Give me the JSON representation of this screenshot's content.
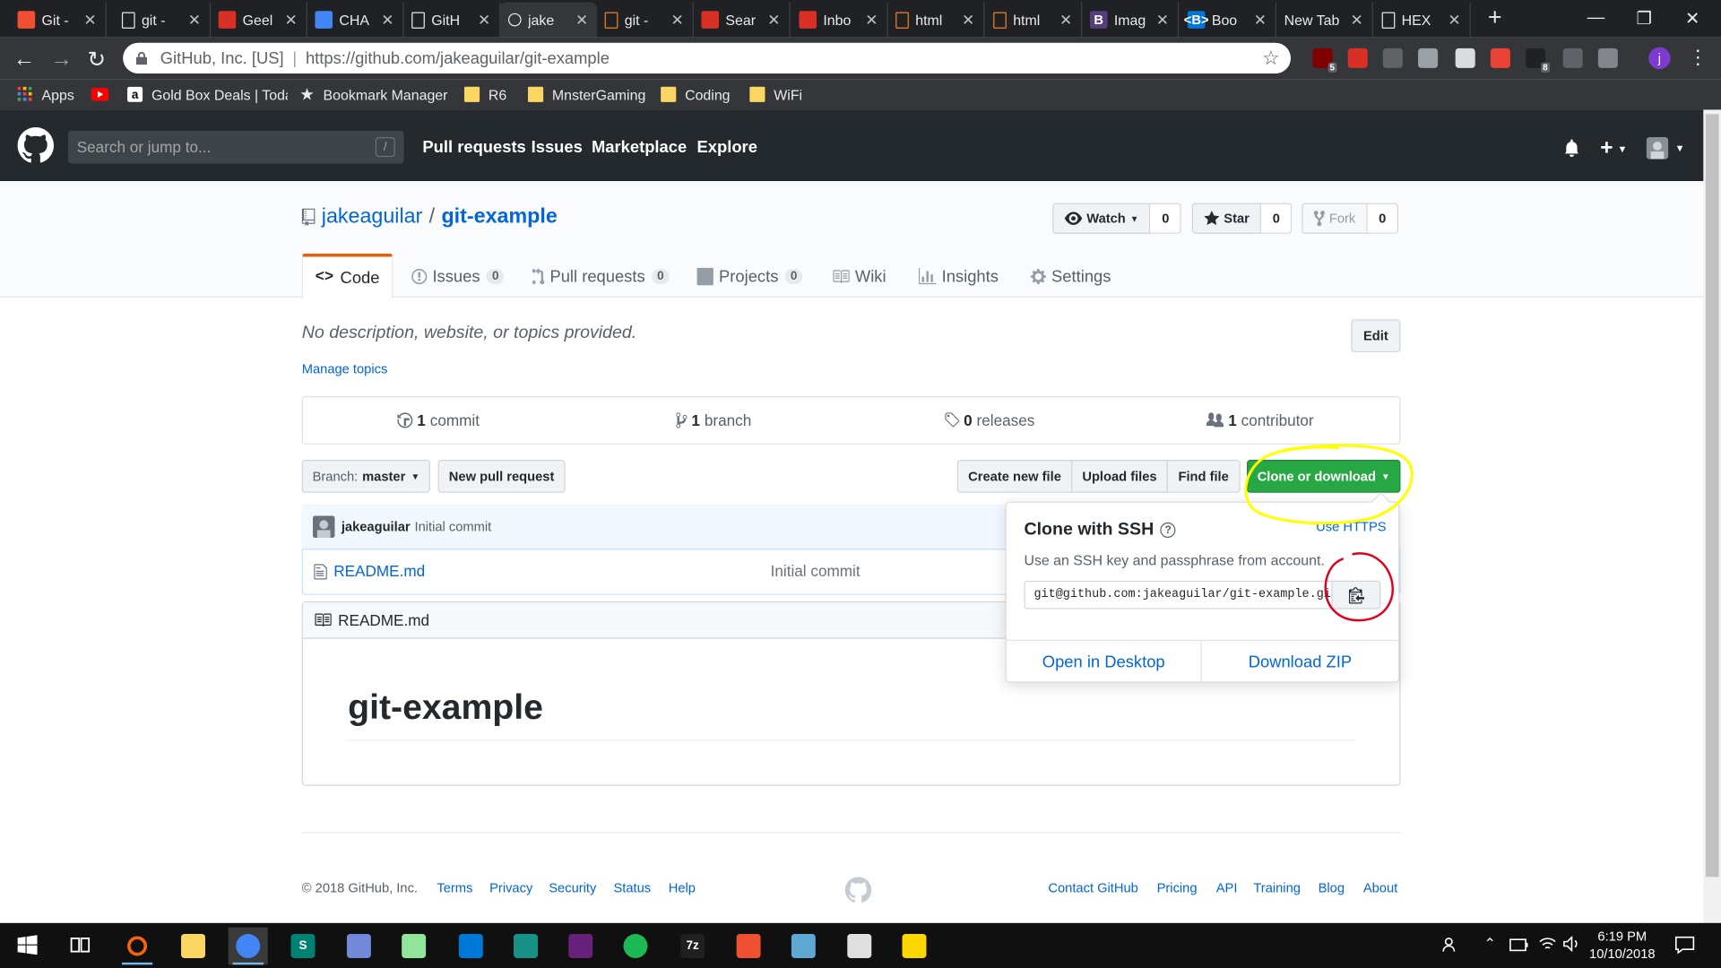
{
  "browser": {
    "tabs": [
      {
        "label": "Git -",
        "icon": "git-logo-icon",
        "icon_color": "#f05032"
      },
      {
        "label": "git -",
        "icon": "document-icon",
        "icon_color": "#e8eaed"
      },
      {
        "label": "Geel",
        "icon": "gmail-icon",
        "icon_color": "#d93025"
      },
      {
        "label": "CHA",
        "icon": "google-docs-icon",
        "icon_color": "#4285f4"
      },
      {
        "label": "GitH",
        "icon": "document-icon",
        "icon_color": "#e8eaed"
      },
      {
        "label": "jake",
        "icon": "github-icon",
        "icon_color": "#e8eaed"
      },
      {
        "label": "git -",
        "icon": "stackoverflow-icon",
        "icon_color": "#f48024"
      },
      {
        "label": "Sear",
        "icon": "gmail-icon",
        "icon_color": "#d93025"
      },
      {
        "label": "Inbo",
        "icon": "gmail-icon",
        "icon_color": "#d93025"
      },
      {
        "label": "html",
        "icon": "stackoverflow-icon",
        "icon_color": "#f48024"
      },
      {
        "label": "html",
        "icon": "stackoverflow-icon",
        "icon_color": "#f48024"
      },
      {
        "label": "Imag",
        "icon": "bootstrap-icon",
        "icon_color": "#563d7c",
        "glyph": "B"
      },
      {
        "label": "Boo",
        "icon": "bootstrap-icon",
        "icon_color": "#0275d8",
        "glyph": "<B>"
      },
      {
        "label": "New Tab",
        "icon": "",
        "icon_color": ""
      },
      {
        "label": "HEX",
        "icon": "document-icon",
        "icon_color": "#e8eaed"
      }
    ],
    "close_glyph": "✕",
    "newtab_glyph": "+",
    "window_controls": {
      "minimize": "—",
      "restore": "❐",
      "close": "✕"
    },
    "nav": {
      "back": "←",
      "forward": "→",
      "reload": "↻"
    },
    "omnibox": {
      "site_identity": "GitHub, Inc. [US]",
      "url": "https://github.com/jakeaguilar/git-example"
    },
    "star_glyph": "☆",
    "extensions": [
      {
        "name": "ublock-icon",
        "color": "#800000",
        "badge": "5"
      },
      {
        "name": "gmail-checker-icon",
        "color": "#d93025",
        "badge": ""
      },
      {
        "name": "extension-icon",
        "color": "#5f6368",
        "badge": ""
      },
      {
        "name": "drive-icon",
        "color": "#9aa0a6",
        "badge": ""
      },
      {
        "name": "circle-extension-icon",
        "color": "#dadce0",
        "badge": ""
      },
      {
        "name": "red-extension-icon",
        "color": "#ea4335",
        "badge": ""
      },
      {
        "name": "amazon-assistant-icon",
        "color": "#202124",
        "badge": "8"
      },
      {
        "name": "pen-extension-icon",
        "color": "#5f6368",
        "badge": ""
      },
      {
        "name": "grey-extension-icon",
        "color": "#80868b",
        "badge": ""
      }
    ],
    "profile_initial": "j",
    "menu_glyph": "⋮",
    "bookmarks": [
      {
        "label": "Apps",
        "kind": "apps"
      },
      {
        "label": "",
        "kind": "youtube"
      },
      {
        "label": "Gold Box Deals | Toda",
        "kind": "amazon"
      },
      {
        "label": "Bookmark Manager",
        "kind": "star"
      },
      {
        "label": "R6",
        "kind": "folder"
      },
      {
        "label": "MnsterGaming",
        "kind": "folder"
      },
      {
        "label": "Coding",
        "kind": "folder"
      },
      {
        "label": "WiFi",
        "kind": "folder"
      }
    ]
  },
  "github": {
    "search_placeholder": "Search or jump to...",
    "search_shortcut": "/",
    "nav": [
      "Pull requests",
      "Issues",
      "Marketplace",
      "Explore"
    ],
    "repo": {
      "owner": "jakeaguilar",
      "separator": "/",
      "name": "git-example",
      "watch_label": "Watch",
      "watch_count": "0",
      "star_label": "Star",
      "star_count": "0",
      "fork_label": "Fork",
      "fork_count": "0"
    },
    "tabs": [
      {
        "label": "Code",
        "count": ""
      },
      {
        "label": "Issues",
        "count": "0"
      },
      {
        "label": "Pull requests",
        "count": "0"
      },
      {
        "label": "Projects",
        "count": "0"
      },
      {
        "label": "Wiki",
        "count": ""
      },
      {
        "label": "Insights",
        "count": ""
      },
      {
        "label": "Settings",
        "count": ""
      }
    ],
    "description": "No description, website, or topics provided.",
    "manage_topics": "Manage topics",
    "edit_label": "Edit",
    "summary": {
      "commits_num": "1",
      "commits_label": "commit",
      "branch_num": "1",
      "branch_label": "branch",
      "releases_num": "0",
      "releases_label": "releases",
      "contributor_num": "1",
      "contributor_label": "contributor"
    },
    "branch_prefix": "Branch:",
    "branch_name": "master",
    "new_pr_label": "New pull request",
    "create_file_label": "Create new file",
    "upload_label": "Upload files",
    "find_label": "Find file",
    "clone_label": "Clone or download",
    "commit": {
      "author": "jakeaguilar",
      "message": "Initial commit"
    },
    "files": [
      {
        "name": "README.md",
        "message": "Initial commit"
      }
    ],
    "readme_header": "README.md",
    "readme_title": "git-example",
    "clone_popup": {
      "title": "Clone with SSH",
      "help_glyph": "?",
      "use_https": "Use HTTPS",
      "description": "Use an SSH key and passphrase from account.",
      "ssh_url": "git@github.com:jakeaguilar/git-example.git",
      "open_desktop": "Open in Desktop",
      "download_zip": "Download ZIP"
    },
    "footer": {
      "copyright": "© 2018 GitHub, Inc.",
      "left_links": [
        "Terms",
        "Privacy",
        "Security",
        "Status",
        "Help"
      ],
      "right_links": [
        "Contact GitHub",
        "Pricing",
        "API",
        "Training",
        "Blog",
        "About"
      ]
    }
  },
  "annotations": {
    "highlight_color": "#ffff00",
    "circle_color": "#e0001b"
  },
  "taskbar": {
    "apps": [
      {
        "name": "search-icon",
        "color": "#f7630c",
        "glyph": ""
      },
      {
        "name": "file-explorer-icon",
        "color": "#fcd663",
        "glyph": ""
      },
      {
        "name": "chrome-icon",
        "color": "#4285f4",
        "glyph": ""
      },
      {
        "name": "sway-icon",
        "color": "#008272",
        "glyph": "S"
      },
      {
        "name": "discord-icon",
        "color": "#7289da",
        "glyph": ""
      },
      {
        "name": "notepadpp-icon",
        "color": "#90e59a",
        "glyph": ""
      },
      {
        "name": "vscode-icon",
        "color": "#0078d7",
        "glyph": ""
      },
      {
        "name": "gitkraken-icon",
        "color": "#179287",
        "glyph": ""
      },
      {
        "name": "visual-studio-icon",
        "color": "#68217a",
        "glyph": ""
      },
      {
        "name": "spotify-icon",
        "color": "#1db954",
        "glyph": ""
      },
      {
        "name": "7zip-icon",
        "color": "#202020",
        "glyph": "7z"
      },
      {
        "name": "git-icon",
        "color": "#f05032",
        "glyph": ""
      },
      {
        "name": "paint-3d-icon",
        "color": "#5fa8d3",
        "glyph": ""
      },
      {
        "name": "photos-icon",
        "color": "#dfdfdf",
        "glyph": ""
      },
      {
        "name": "paint-icon",
        "color": "#ffd700",
        "glyph": ""
      }
    ],
    "time": "6:19 PM",
    "date": "10/10/2018"
  }
}
